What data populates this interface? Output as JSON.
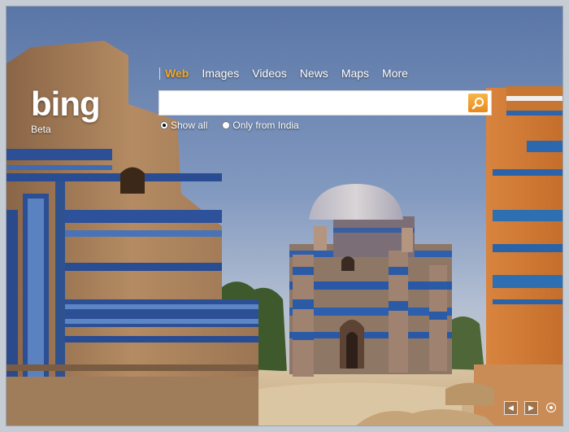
{
  "logo": {
    "text": "bing",
    "subtitle": "Beta"
  },
  "nav": {
    "items": [
      {
        "label": "Web",
        "active": true
      },
      {
        "label": "Images"
      },
      {
        "label": "Videos"
      },
      {
        "label": "News"
      },
      {
        "label": "Maps"
      },
      {
        "label": "More"
      }
    ]
  },
  "search": {
    "value": "",
    "button_icon": "search-icon"
  },
  "scope": {
    "options": [
      {
        "label": "Show all",
        "checked": true
      },
      {
        "label": "Only from India",
        "checked": false
      }
    ]
  },
  "controls": {
    "prev_icon": "◀",
    "next_icon": "▶",
    "info_icon": "info-icon"
  },
  "colors": {
    "accent": "#f5a623",
    "text": "#ffffff"
  }
}
